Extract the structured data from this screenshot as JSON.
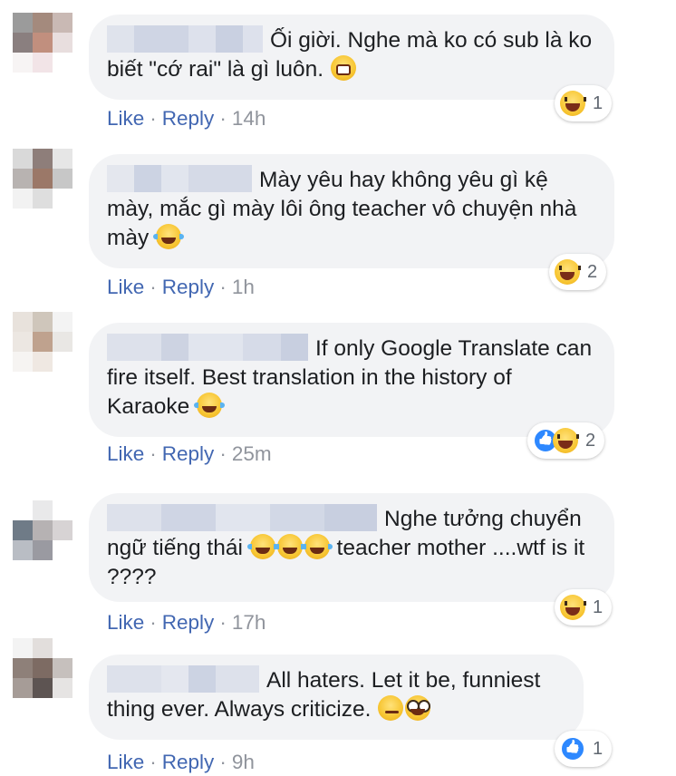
{
  "comments": [
    {
      "text": "Ối giời. Nghe mà ko có sub là ko biết \"cớ rai\" là gì luôn.",
      "emoji": [
        "grin-emoji"
      ],
      "actions": {
        "like": "Like",
        "reply": "Reply",
        "time": "14h"
      },
      "reactions": {
        "icons": [
          "haha"
        ],
        "count": "1"
      }
    },
    {
      "text": "Mày yêu hay không yêu gì kệ mày, mắc gì mày lôi ông teacher vô chuyện nhà mày",
      "emoji": [
        "tears-of-joy-emoji"
      ],
      "actions": {
        "like": "Like",
        "reply": "Reply",
        "time": "1h"
      },
      "reactions": {
        "icons": [
          "haha"
        ],
        "count": "2"
      }
    },
    {
      "text": "If only Google Translate can fire itself. Best translation in the history of Karaoke",
      "emoji": [
        "tears-of-joy-emoji"
      ],
      "actions": {
        "like": "Like",
        "reply": "Reply",
        "time": "25m"
      },
      "reactions": {
        "icons": [
          "like",
          "haha"
        ],
        "count": "2"
      }
    },
    {
      "text_a": "Nghe tưởng chuyển ngữ tiếng thái",
      "text_b": "teacher mother ....wtf is it ????",
      "emoji": [
        "rofl-emoji",
        "rofl-emoji",
        "rofl-emoji"
      ],
      "actions": {
        "like": "Like",
        "reply": "Reply",
        "time": "17h"
      },
      "reactions": {
        "icons": [
          "haha"
        ],
        "count": "1"
      }
    },
    {
      "text": "All haters. Let it be, funniest thing ever. Always criticize.",
      "emoji": [
        "smirk-emoji",
        "nerd-emoji"
      ],
      "actions": {
        "like": "Like",
        "reply": "Reply",
        "time": "9h"
      },
      "reactions": {
        "icons": [
          "like"
        ],
        "count": "1"
      }
    }
  ],
  "separator": "·",
  "colors": {
    "link": "#4267b2",
    "meta": "#90949c",
    "bubble": "#f2f3f5",
    "like_blue": "#2d88ff"
  }
}
